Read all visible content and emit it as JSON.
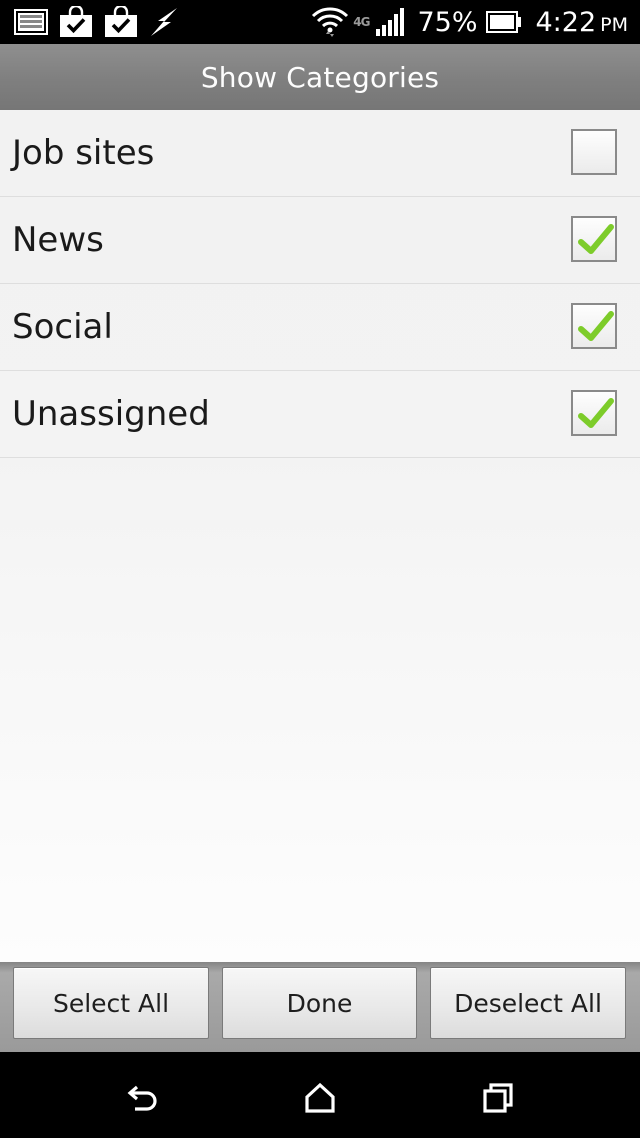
{
  "status_bar": {
    "icons_left": [
      "gallery-icon",
      "shopping-bag-check-icon",
      "shopping-bag-check-icon",
      "usb-charging-icon"
    ],
    "network_label": "4G",
    "battery_percent": "75%",
    "time": "4:22",
    "ampm": "PM"
  },
  "title_bar": {
    "title": "Show Categories"
  },
  "categories": [
    {
      "label": "Job sites",
      "checked": false
    },
    {
      "label": "News",
      "checked": true
    },
    {
      "label": "Social",
      "checked": true
    },
    {
      "label": "Unassigned",
      "checked": true
    }
  ],
  "buttons": {
    "select_all": "Select All",
    "done": "Done",
    "deselect_all": "Deselect All"
  },
  "nav_bar": {
    "icons": [
      "back-icon",
      "home-icon",
      "recent-apps-icon"
    ]
  },
  "colors": {
    "checkmark": "#7dcc2a",
    "title_bar": "#828282",
    "button_bar": "#9a9a9a"
  }
}
